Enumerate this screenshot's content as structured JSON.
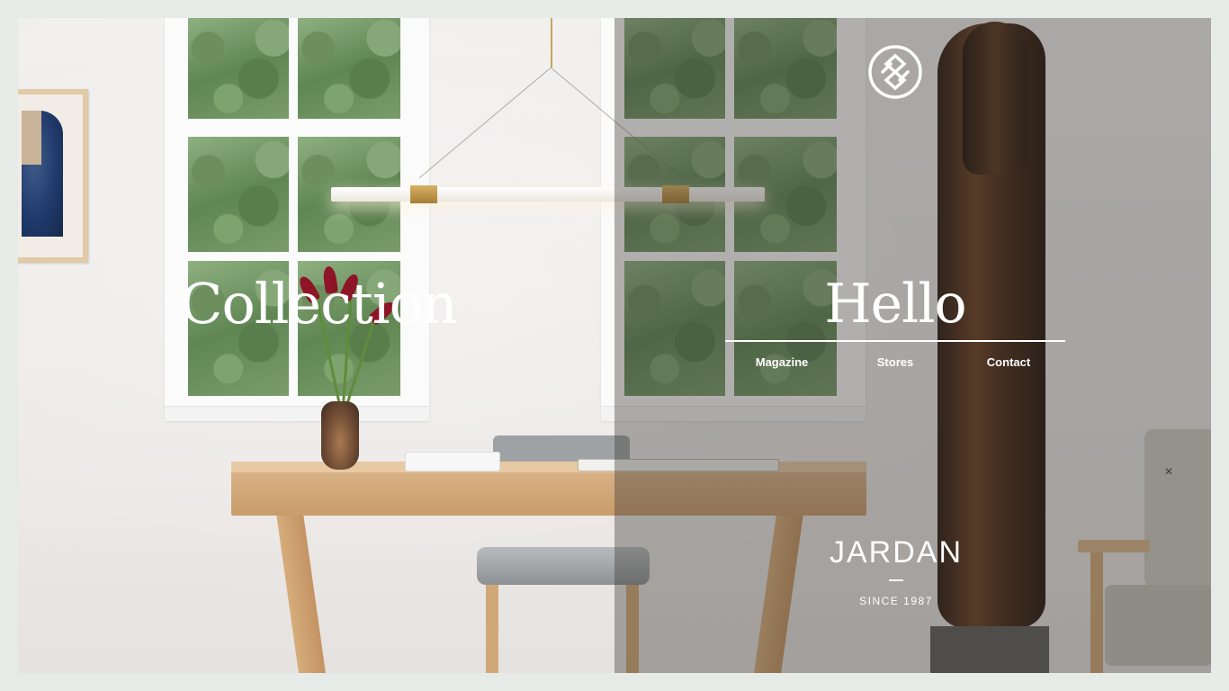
{
  "left_panel": {
    "title": "Collection"
  },
  "right_panel": {
    "title": "Hello",
    "nav": [
      {
        "label": "Magazine"
      },
      {
        "label": "Stores"
      },
      {
        "label": "Contact"
      }
    ]
  },
  "brand": {
    "name": "JARDAN",
    "tagline": "SINCE 1987",
    "logo_icon": "interlocking-knot-icon"
  },
  "controls": {
    "close_glyph": "×"
  },
  "colors": {
    "page_background": "#e6ebe8",
    "text_light": "#ffffff",
    "overlay": "#37342f"
  }
}
